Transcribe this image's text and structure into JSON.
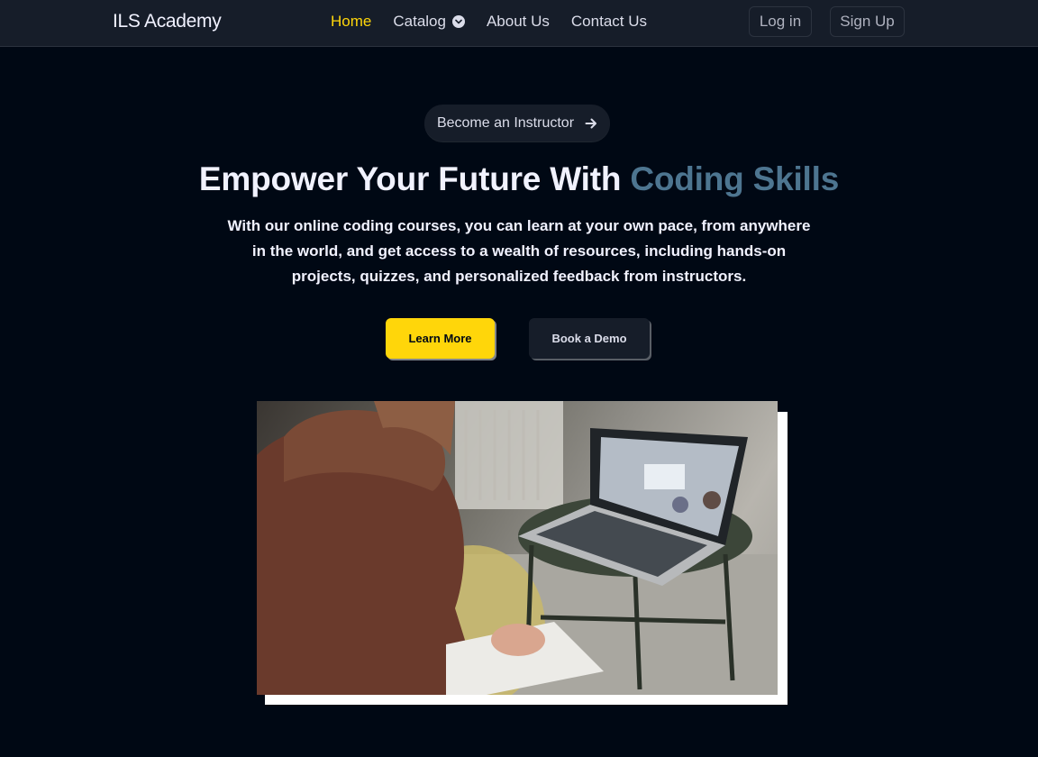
{
  "navbar": {
    "brand": "ILS Academy",
    "links": [
      {
        "label": "Home",
        "active": true
      },
      {
        "label": "Catalog",
        "has_dropdown": true
      },
      {
        "label": "About Us"
      },
      {
        "label": "Contact Us"
      }
    ],
    "login_label": "Log in",
    "signup_label": "Sign Up"
  },
  "hero": {
    "instructor_label": "Become an Instructor",
    "headline_prefix": "Empower Your Future With ",
    "headline_highlight": "Coding Skills",
    "subtext": "With our online coding courses, you can learn at your own pace, from anywhere in the world, and get access to a wealth of resources, including hands-on projects, quizzes, and personalized feedback from instructors.",
    "primary_cta": "Learn More",
    "secondary_cta": "Book a Demo"
  },
  "icons": {
    "catalog": "chevron-down-icon",
    "instructor": "arrow-right-icon"
  },
  "colors": {
    "background": "#000814",
    "navbar": "#161d29",
    "accent_yellow": "#ffd60a",
    "highlight_blue": "#4d7590"
  }
}
